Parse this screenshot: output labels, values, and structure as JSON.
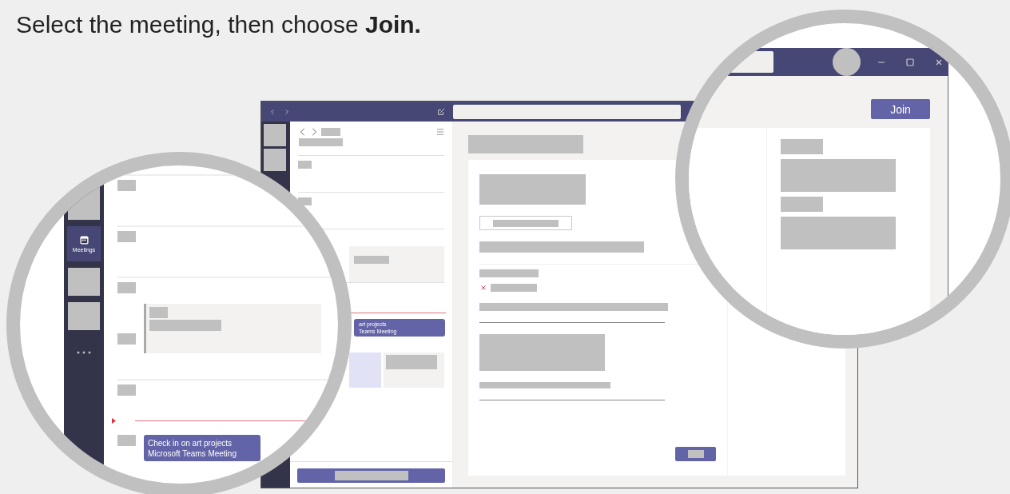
{
  "instruction": "Select the meeting, then choose **Join.**",
  "sidebar": {
    "items": [
      {
        "kind": "placeholder",
        "selected": false
      },
      {
        "kind": "app",
        "label": "Meetings",
        "selected": true
      },
      {
        "kind": "placeholder",
        "selected": false
      },
      {
        "kind": "placeholder",
        "selected": false
      },
      {
        "kind": "more",
        "selected": false
      }
    ]
  },
  "meeting_list": {
    "event": {
      "title": "art projects",
      "subtitle": "Teams Meeting"
    }
  },
  "calendar_zoom": {
    "event": {
      "title": "Check  in  on art projects",
      "subtitle": "Microsoft  Teams Meeting"
    }
  },
  "meeting_details": {
    "join_button": "Join"
  }
}
